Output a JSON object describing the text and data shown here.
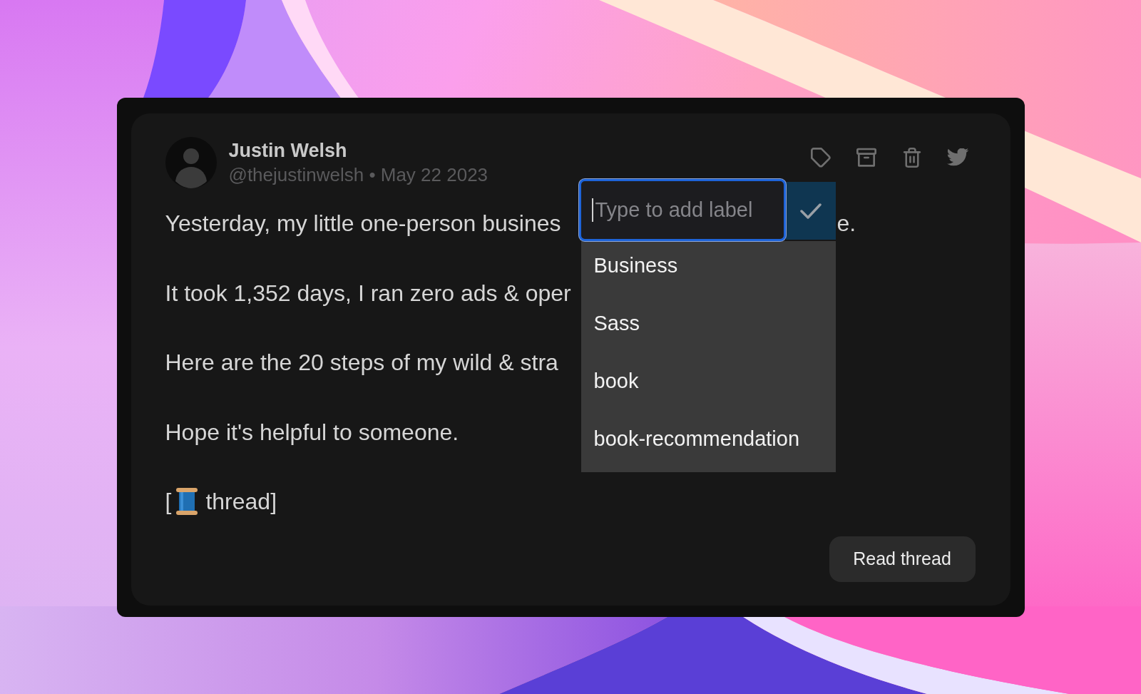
{
  "post": {
    "author": {
      "name": "Justin Welsh",
      "meta": "@thejustinwelsh • May 22 2023"
    },
    "paragraphs": [
      {
        "text": "Yesterday, my little one-person busines",
        "tail": "e."
      },
      {
        "text": "It took 1,352 days, I ran zero ads & oper"
      },
      {
        "text": "Here are the 20 steps of my wild & stra"
      },
      {
        "text": "Hope it's helpful to someone."
      }
    ],
    "thread_marker": {
      "open": "[",
      "label": "thread]"
    },
    "read_button": "Read thread"
  },
  "label_picker": {
    "placeholder": "Type to add label",
    "focused": true,
    "options": [
      {
        "label": "Business"
      },
      {
        "label": "Sass"
      },
      {
        "label": "book"
      },
      {
        "label": "book-recommendation"
      }
    ]
  }
}
